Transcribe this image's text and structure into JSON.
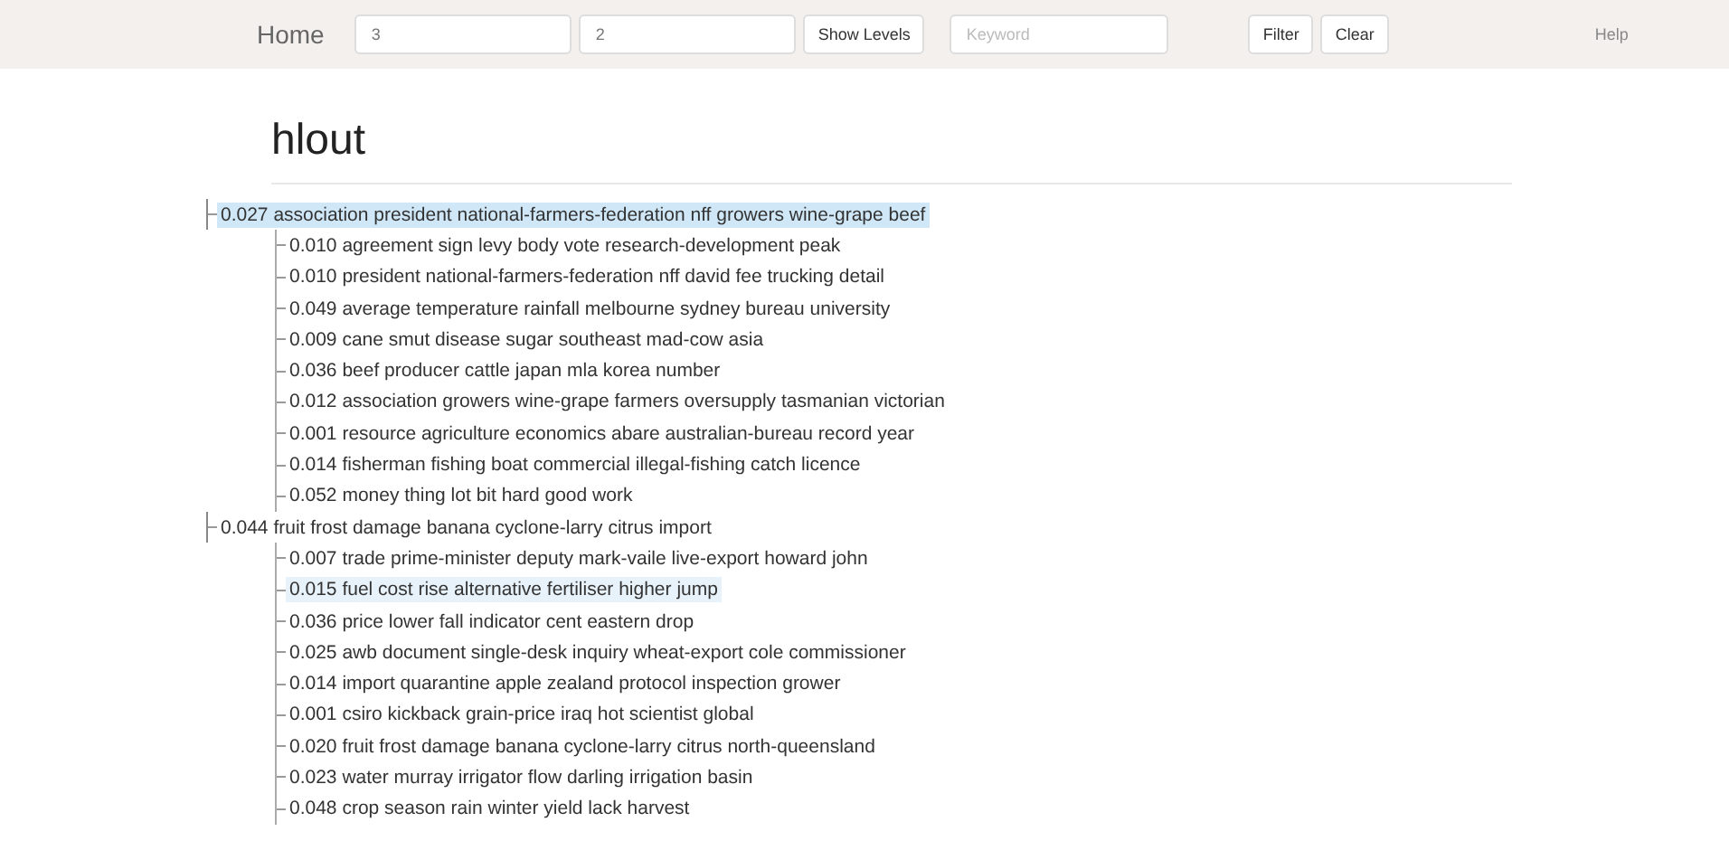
{
  "navbar": {
    "brand": "Home",
    "level_fields": [
      {
        "value": "3"
      },
      {
        "value": "2"
      }
    ],
    "show_button": "Show Levels",
    "keyword": {
      "placeholder": "Keyword"
    },
    "filter_button": "Filter",
    "clear_button": "Clear",
    "help": "Help"
  },
  "title": "hlout",
  "tree": [
    {
      "label": "0.027 association president national-farmers-federation nff growers wine-grape beef",
      "selected": true,
      "hovered": false,
      "expanded": true,
      "children": [
        {
          "label": "0.010 agreement sign levy body vote research-development peak",
          "selected": false,
          "hovered": false
        },
        {
          "label": "0.010 president national-farmers-federation nff david fee trucking detail",
          "selected": false,
          "hovered": false
        },
        {
          "label": "0.049 average temperature rainfall melbourne sydney bureau university",
          "selected": false,
          "hovered": false
        },
        {
          "label": "0.009 cane smut disease sugar southeast mad-cow asia",
          "selected": false,
          "hovered": false
        },
        {
          "label": "0.036 beef producer cattle japan mla korea number",
          "selected": false,
          "hovered": false
        },
        {
          "label": "0.012 association growers wine-grape farmers oversupply tasmanian victorian",
          "selected": false,
          "hovered": false
        },
        {
          "label": "0.001 resource agriculture economics abare australian-bureau record year",
          "selected": false,
          "hovered": false
        },
        {
          "label": "0.014 fisherman fishing boat commercial illegal-fishing catch licence",
          "selected": false,
          "hovered": false
        },
        {
          "label": "0.052 money thing lot bit hard good work",
          "selected": false,
          "hovered": false
        }
      ]
    },
    {
      "label": "0.044 fruit frost damage banana cyclone-larry citrus import",
      "selected": false,
      "hovered": false,
      "expanded": true,
      "children": [
        {
          "label": "0.007 trade prime-minister deputy mark-vaile live-export howard john",
          "selected": false,
          "hovered": false
        },
        {
          "label": "0.015 fuel cost rise alternative fertiliser higher jump",
          "selected": false,
          "hovered": true
        },
        {
          "label": "0.036 price lower fall indicator cent eastern drop",
          "selected": false,
          "hovered": false
        },
        {
          "label": "0.025 awb document single-desk inquiry wheat-export cole commissioner",
          "selected": false,
          "hovered": false
        },
        {
          "label": "0.014 import quarantine apple zealand protocol inspection grower",
          "selected": false,
          "hovered": false
        },
        {
          "label": "0.001 csiro kickback grain-price iraq hot scientist global",
          "selected": false,
          "hovered": false
        },
        {
          "label": "0.020 fruit frost damage banana cyclone-larry citrus north-queensland",
          "selected": false,
          "hovered": false
        },
        {
          "label": "0.023 water murray irrigator flow darling irrigation basin",
          "selected": false,
          "hovered": false
        },
        {
          "label": "0.048 crop season rain winter yield lack harvest",
          "selected": false,
          "hovered": false
        }
      ]
    }
  ]
}
